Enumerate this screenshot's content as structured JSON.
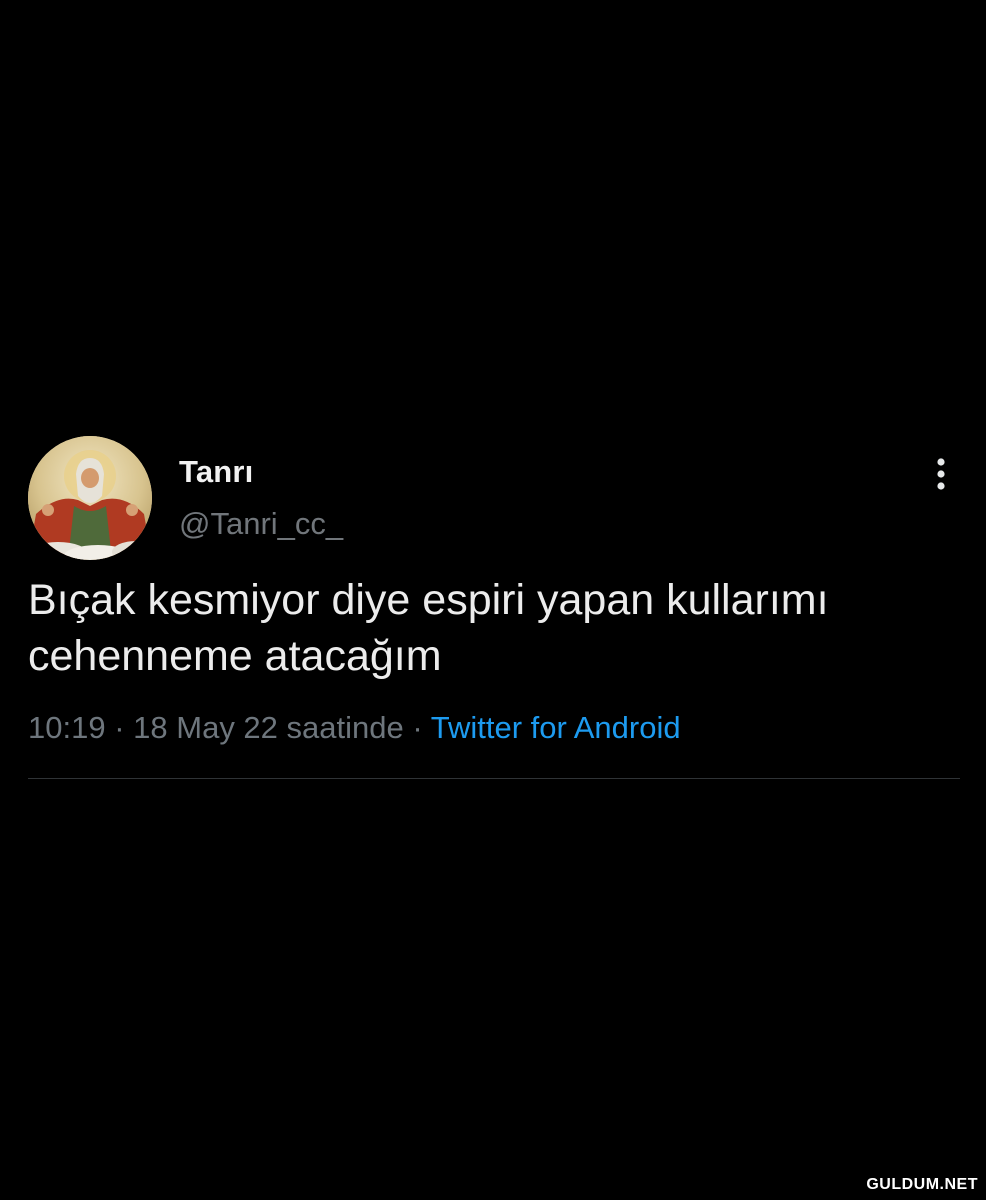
{
  "tweet": {
    "author": {
      "display_name": "Tanrı",
      "handle": "@Tanri_cc_",
      "avatar": "painting-of-god-avatar"
    },
    "text": "Bıçak kesmiyor diye espiri yapan kullarımı cehenneme atacağım",
    "time": "10:19",
    "separator": "·",
    "date": "18 May 22 saatinde",
    "source": "Twitter for Android",
    "more_icon": "more-vertical-icon"
  },
  "watermark": "GULDUM.NET",
  "colors": {
    "background": "#000000",
    "text": "#ececec",
    "secondary": "#71767b",
    "link": "#1d9bf0",
    "divider": "#2f3336"
  }
}
